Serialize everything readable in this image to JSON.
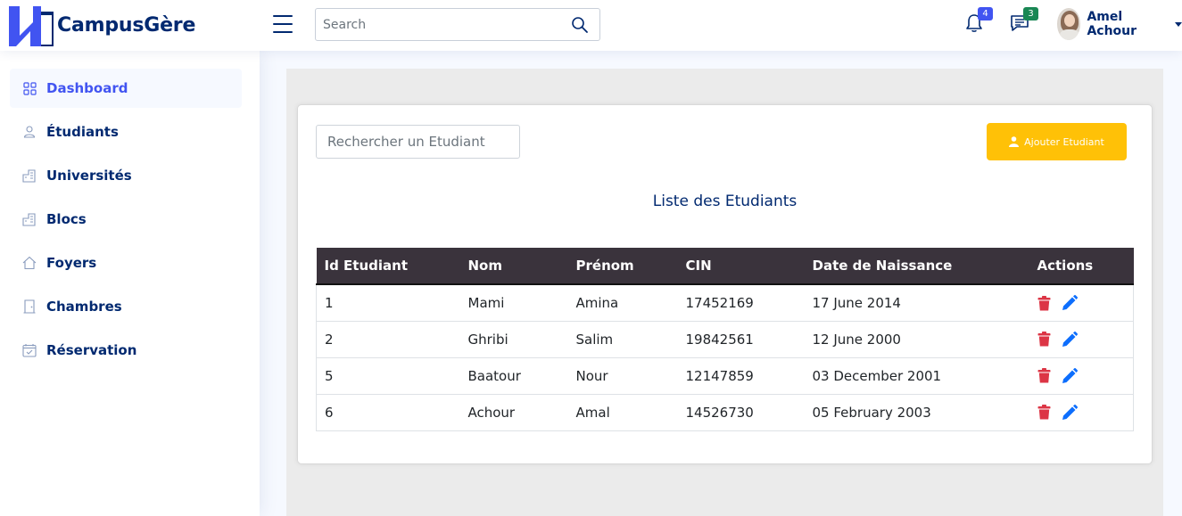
{
  "header": {
    "brand": "CampusGère",
    "search_placeholder": "Search",
    "notifications_count": "4",
    "messages_count": "3",
    "user_name": "Amel Achour"
  },
  "sidebar": {
    "items": [
      {
        "label": "Dashboard",
        "icon": "grid-icon",
        "active": true
      },
      {
        "label": "Étudiants",
        "icon": "person-icon"
      },
      {
        "label": "Universités",
        "icon": "building-icon"
      },
      {
        "label": "Blocs",
        "icon": "building-icon"
      },
      {
        "label": "Foyers",
        "icon": "house-icon"
      },
      {
        "label": "Chambres",
        "icon": "door-icon"
      },
      {
        "label": "Réservation",
        "icon": "calendar-check-icon"
      }
    ]
  },
  "main": {
    "search_placeholder": "Rechercher un Etudiant",
    "add_button_label": "Ajouter Etudiant",
    "title": "Liste des Etudiants",
    "columns": [
      "Id Etudiant",
      "Nom",
      "Prénom",
      "CIN",
      "Date de Naissance",
      "Actions"
    ],
    "rows": [
      [
        "1",
        "Mami",
        "Amina",
        "17452169",
        "17 June 2014"
      ],
      [
        "2",
        "Ghribi",
        "Salim",
        "19842561",
        "12 June 2000"
      ],
      [
        "5",
        "Baatour",
        "Nour",
        "12147859",
        "03 December 2001"
      ],
      [
        "6",
        "Achour",
        "Amal",
        "14526730",
        "05 February 2003"
      ]
    ]
  },
  "colors": {
    "brand": "#012970",
    "accent": "#4154f1",
    "warning": "#ffc107",
    "danger": "#dc3545",
    "edit": "#0d6efd",
    "table_header": "#3a333c"
  }
}
